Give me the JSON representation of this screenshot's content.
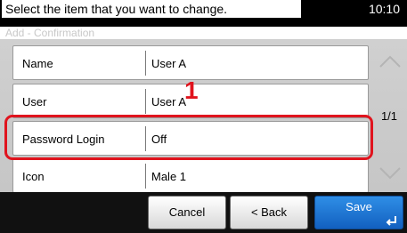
{
  "status": {
    "message": "Select the item that you want to change.",
    "time": "10:10"
  },
  "screen": {
    "subtitle": "Add - Confirmation"
  },
  "rows": [
    {
      "label": "Name",
      "value": "User A"
    },
    {
      "label": "User",
      "value": "User A"
    },
    {
      "label": "Password Login",
      "value": "Off"
    },
    {
      "label": "Icon",
      "value": "Male 1"
    }
  ],
  "annotation": {
    "step": "1"
  },
  "pager": {
    "page": "1/1"
  },
  "footer": {
    "cancel": "Cancel",
    "back": "< Back",
    "save": "Save"
  },
  "colors": {
    "accent_blue": "#1e78d8",
    "highlight_red": "#e0141e"
  }
}
